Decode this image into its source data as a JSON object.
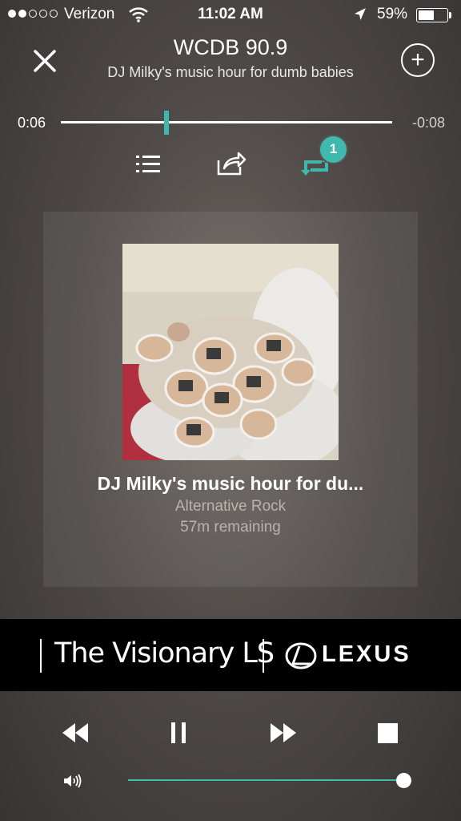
{
  "status_bar": {
    "carrier": "Verizon",
    "time": "11:02 AM",
    "battery": "59%",
    "battery_level": 0.59,
    "signal_bars_filled": 2,
    "signal_bars_total": 5
  },
  "header": {
    "title": "WCDB 90.9",
    "subtitle": "DJ Milky's music hour for dumb babies",
    "close_icon": "close-icon",
    "add_icon": "plus-circle-icon",
    "add_symbol": "+"
  },
  "progress": {
    "elapsed": "0:06",
    "remaining": "-0:08",
    "fraction": 0.32
  },
  "actions": {
    "list_icon": "list-icon",
    "share_icon": "share-icon",
    "repost_icon": "repost-icon",
    "repost_badge": "1"
  },
  "now_playing": {
    "title": "DJ Milky's music hour for du...",
    "genre": "Alternative Rock",
    "remaining": "57m remaining"
  },
  "ad": {
    "tagline": "The Visionary LS",
    "brand": "LEXUS"
  },
  "controls": {
    "rewind_icon": "rewind-icon",
    "pause_icon": "pause-icon",
    "fast_forward_icon": "fast-forward-icon",
    "stop_icon": "stop-icon"
  },
  "volume": {
    "icon": "volume-icon",
    "level": 1.0
  },
  "colors": {
    "accent": "#3fb8ad",
    "background": "#4f4a47"
  }
}
